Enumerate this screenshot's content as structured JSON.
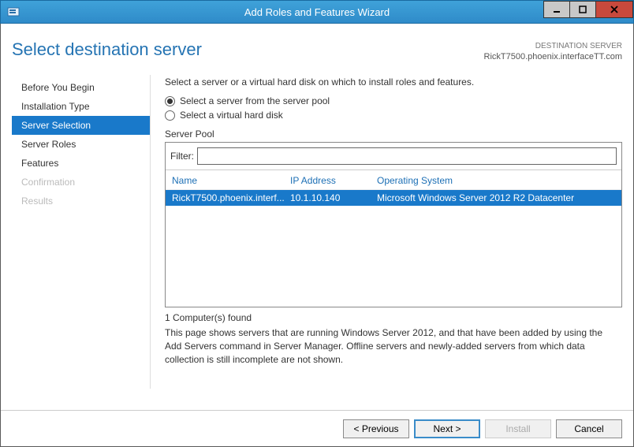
{
  "window": {
    "title": "Add Roles and Features Wizard"
  },
  "header": {
    "page_title": "Select destination server",
    "dest_label": "DESTINATION SERVER",
    "dest_value": "RickT7500.phoenix.interfaceTT.com"
  },
  "sidebar": {
    "items": [
      {
        "label": "Before You Begin",
        "disabled": false
      },
      {
        "label": "Installation Type",
        "disabled": false
      },
      {
        "label": "Server Selection",
        "selected": true
      },
      {
        "label": "Server Roles",
        "disabled": false
      },
      {
        "label": "Features",
        "disabled": false
      },
      {
        "label": "Confirmation",
        "disabled": true
      },
      {
        "label": "Results",
        "disabled": true
      }
    ]
  },
  "main": {
    "intro": "Select a server or a virtual hard disk on which to install roles and features.",
    "radio1": "Select a server from the server pool",
    "radio2": "Select a virtual hard disk",
    "pool_label": "Server Pool",
    "filter_label": "Filter:",
    "columns": {
      "name": "Name",
      "ip": "IP Address",
      "os": "Operating System"
    },
    "rows": [
      {
        "name": "RickT7500.phoenix.interf...",
        "ip": "10.1.10.140",
        "os": "Microsoft Windows Server 2012 R2 Datacenter"
      }
    ],
    "found": "1 Computer(s) found",
    "note": "This page shows servers that are running Windows Server 2012, and that have been added by using the Add Servers command in Server Manager. Offline servers and newly-added servers from which data collection is still incomplete are not shown."
  },
  "footer": {
    "previous": "< Previous",
    "next": "Next >",
    "install": "Install",
    "cancel": "Cancel"
  }
}
